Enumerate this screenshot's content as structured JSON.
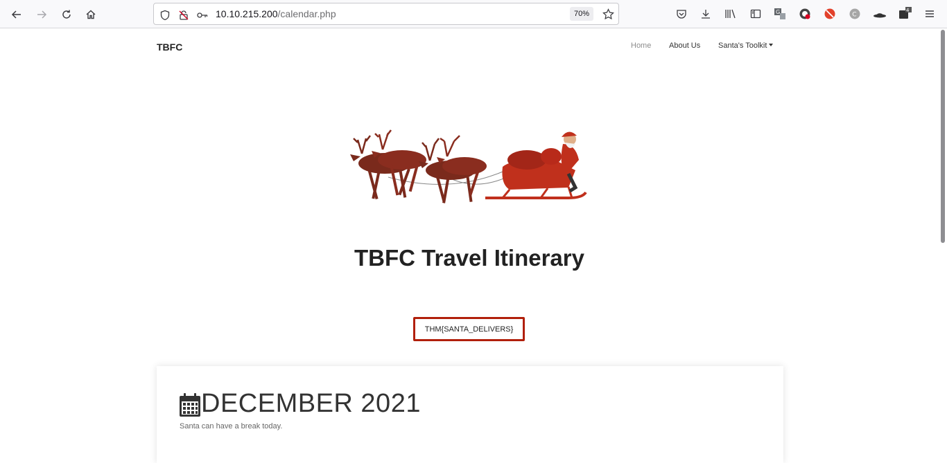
{
  "browser": {
    "url_host": "10.10.215.200",
    "url_path": "/calendar.php",
    "zoom": "70%"
  },
  "site": {
    "brand": "TBFC",
    "nav": {
      "home": "Home",
      "about": "About Us",
      "toolkit": "Santa's Toolkit"
    },
    "title": "TBFC Travel Itinerary",
    "flag": "THM{SANTA_DELIVERS}",
    "calendar": {
      "month": "DECEMBER 2021",
      "note": "Santa can have a break today."
    }
  },
  "colors": {
    "accent_red": "#b11f0a"
  }
}
